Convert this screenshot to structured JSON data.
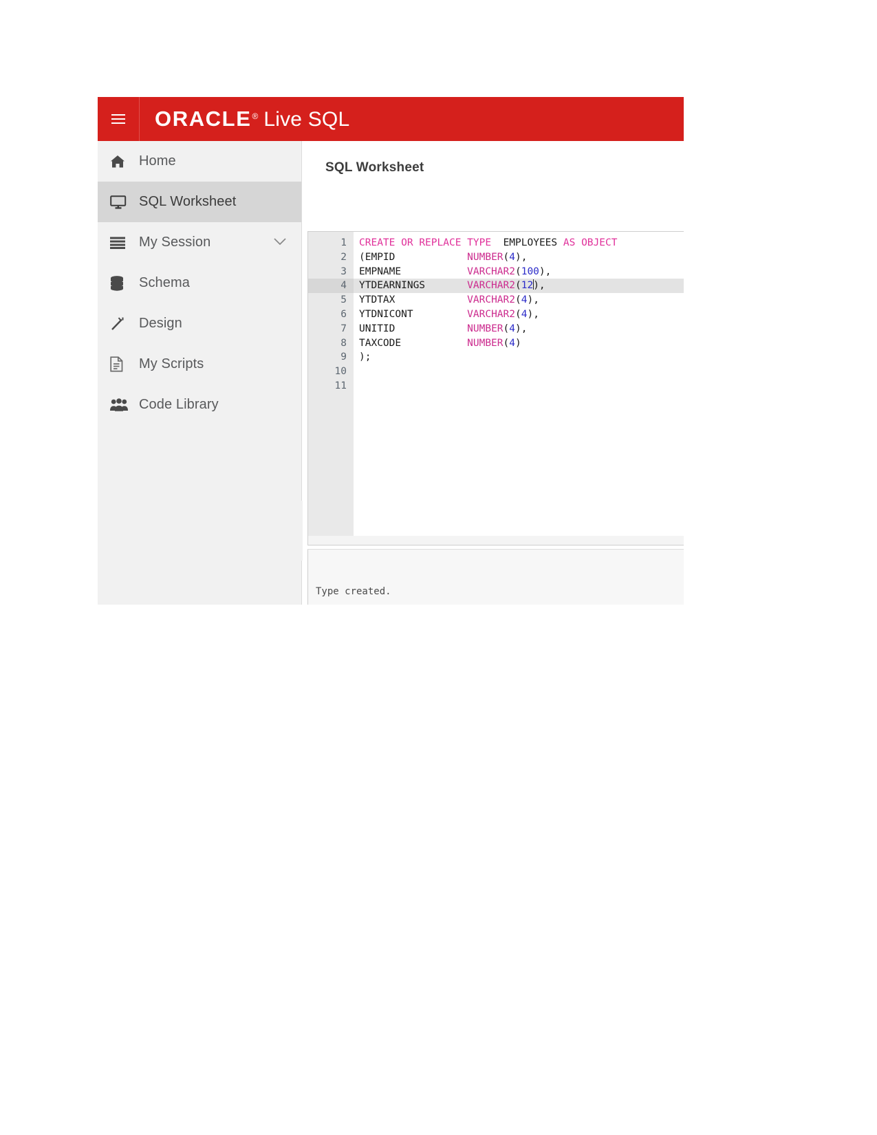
{
  "header": {
    "menu_icon": "hamburger-icon",
    "brand_oracle": "ORACLE",
    "brand_reg": "®",
    "brand_product": "Live SQL"
  },
  "sidebar": {
    "items": [
      {
        "label": "Home",
        "icon": "home-icon",
        "active": false,
        "chevron": false
      },
      {
        "label": "SQL Worksheet",
        "icon": "monitor-icon",
        "active": true,
        "chevron": false
      },
      {
        "label": "My Session",
        "icon": "list-icon",
        "active": false,
        "chevron": true
      },
      {
        "label": "Schema",
        "icon": "database-icon",
        "active": false,
        "chevron": false
      },
      {
        "label": "Design",
        "icon": "magic-wand-icon",
        "active": false,
        "chevron": false
      },
      {
        "label": "My Scripts",
        "icon": "document-icon",
        "active": false,
        "chevron": false
      },
      {
        "label": "Code Library",
        "icon": "users-icon",
        "active": false,
        "chevron": false
      }
    ]
  },
  "main": {
    "title": "SQL Worksheet",
    "editor": {
      "active_line": 4,
      "total_lines": 11,
      "line_numbers": [
        "1",
        "2",
        "3",
        "4",
        "5",
        "6",
        "7",
        "8",
        "9",
        "10",
        "11"
      ],
      "lines": [
        "CREATE OR REPLACE TYPE  EMPLOYEES AS OBJECT",
        "(EMPID            NUMBER(4),",
        "EMPNAME           VARCHAR2(100),",
        "YTDEARNINGS       VARCHAR2(12),",
        "YTDTAX            VARCHAR2(4),",
        "YTDNICONT         VARCHAR2(4),",
        "UNITID            NUMBER(4),",
        "TAXCODE           NUMBER(4)",
        ");",
        "",
        ""
      ]
    },
    "result": {
      "message": "Type created."
    }
  },
  "colors": {
    "brand_red": "#d5201c",
    "sidebar_bg": "#f1f1f1",
    "active_nav_bg": "#d6d6d6",
    "keyword": "#e0309a",
    "number": "#2b2bc9",
    "identifier": "#1a1a1a",
    "gutter_bg": "#e9e9e9",
    "result_bg": "#f7f7f7"
  }
}
